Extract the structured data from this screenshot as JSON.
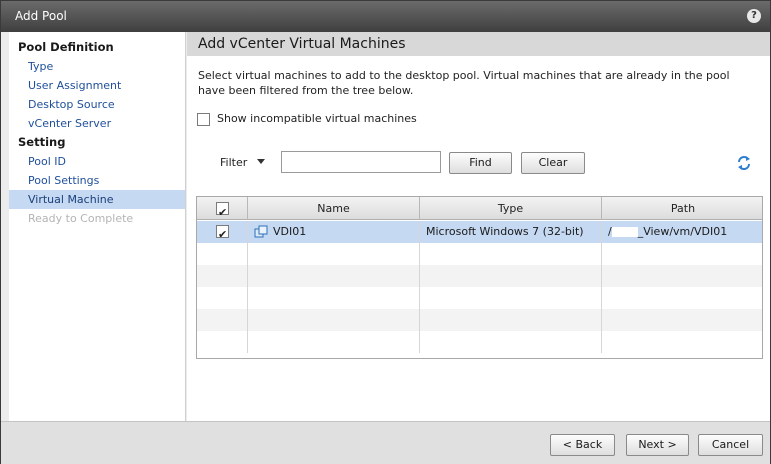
{
  "window": {
    "title": "Add Pool",
    "help_symbol": "?"
  },
  "nav": {
    "sections": [
      {
        "heading": "Pool Definition",
        "items": [
          "Type",
          "User Assignment",
          "Desktop Source",
          "vCenter Server"
        ]
      },
      {
        "heading": "Setting",
        "items": [
          "Pool ID",
          "Pool Settings",
          "Virtual Machine",
          "Ready to Complete"
        ]
      }
    ],
    "active_item": "Virtual Machine",
    "disabled_item": "Ready to Complete"
  },
  "panel": {
    "title": "Add vCenter Virtual Machines",
    "description": "Select virtual machines to add to the desktop pool. Virtual machines that are already in the pool have been filtered from the tree below.",
    "show_incompatible_label": "Show incompatible virtual machines",
    "show_incompatible_checked": false
  },
  "filter": {
    "label": "Filter",
    "input_value": "",
    "find_label": "Find",
    "clear_label": "Clear"
  },
  "table": {
    "columns": [
      "Name",
      "Type",
      "Path"
    ],
    "header_checked": true,
    "rows": [
      {
        "checked": true,
        "name": "VDI01",
        "type": "Microsoft Windows 7 (32-bit)",
        "path_prefix": "/",
        "path_suffix": "_View/vm/VDI01"
      }
    ]
  },
  "footer": {
    "back_label": "< Back",
    "next_label": "Next >",
    "cancel_label": "Cancel"
  },
  "colors": {
    "selection": "#c6d9f2",
    "link": "#1f4f9a",
    "titlebar": "#4a4a4a"
  }
}
